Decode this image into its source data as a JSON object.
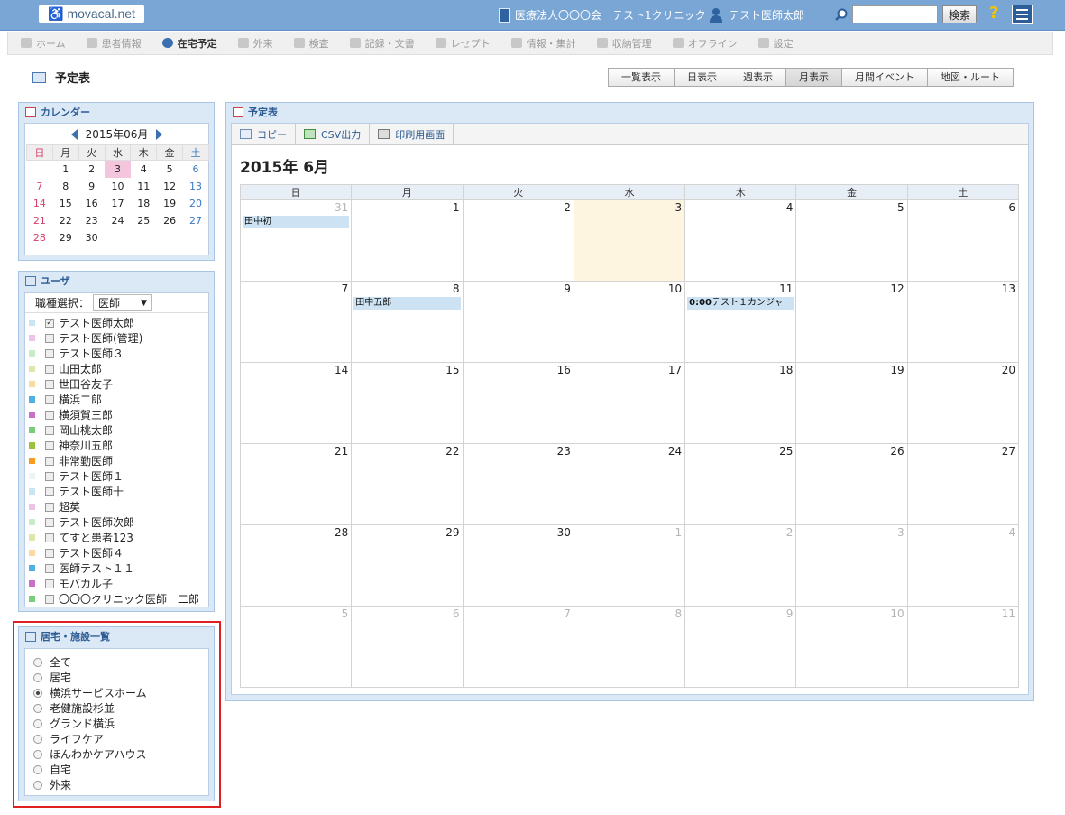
{
  "app": {
    "logo_text": "movacal.net",
    "organization": "医療法人〇〇〇会　テスト1クリニック",
    "username": "テスト医師太郎",
    "search_placeholder": "",
    "search_button": "検索",
    "help_label": "?"
  },
  "nav": [
    {
      "label": "ホーム",
      "icon": "home-icon",
      "active": false
    },
    {
      "label": "患者情報",
      "icon": "patients-icon",
      "active": false
    },
    {
      "label": "在宅予定",
      "icon": "clock-icon",
      "active": true
    },
    {
      "label": "外来",
      "icon": "outpatient-icon",
      "active": false
    },
    {
      "label": "検査",
      "icon": "exam-icon",
      "active": false
    },
    {
      "label": "記録・文書",
      "icon": "documents-icon",
      "active": false
    },
    {
      "label": "レセプト",
      "icon": "receipt-icon",
      "active": false
    },
    {
      "label": "情報・集計",
      "icon": "stats-icon",
      "active": false
    },
    {
      "label": "収納管理",
      "icon": "billing-icon",
      "active": false
    },
    {
      "label": "オフライン",
      "icon": "offline-icon",
      "active": false
    },
    {
      "label": "設定",
      "icon": "settings-icon",
      "active": false
    }
  ],
  "page": {
    "title": "予定表",
    "views": [
      "一覧表示",
      "日表示",
      "週表示",
      "月表示",
      "月間イベント",
      "地図・ルート"
    ],
    "active_view": "月表示"
  },
  "calendar_panel": {
    "title": "カレンダー",
    "month": "2015年06月",
    "weekdays": [
      "日",
      "月",
      "火",
      "水",
      "木",
      "金",
      "土"
    ],
    "weeks": [
      [
        "",
        "1",
        "2",
        "3",
        "4",
        "5",
        "6"
      ],
      [
        "7",
        "8",
        "9",
        "10",
        "11",
        "12",
        "13"
      ],
      [
        "14",
        "15",
        "16",
        "17",
        "18",
        "19",
        "20"
      ],
      [
        "21",
        "22",
        "23",
        "24",
        "25",
        "26",
        "27"
      ],
      [
        "28",
        "29",
        "30",
        "",
        "",
        "",
        ""
      ]
    ],
    "today": "3"
  },
  "users_panel": {
    "title": "ユーザ",
    "role_label": "職種選択：",
    "role_value": "医師",
    "users": [
      {
        "name": "テスト医師太郎",
        "color": "#c9e4f3",
        "checked": true
      },
      {
        "name": "テスト医師(管理)",
        "color": "#ebc4e8",
        "checked": false
      },
      {
        "name": "テスト医師３",
        "color": "#c8ecc8",
        "checked": false
      },
      {
        "name": "山田太郎",
        "color": "#dde8a8",
        "checked": false
      },
      {
        "name": "世田谷友子",
        "color": "#fbd9a0",
        "checked": false
      },
      {
        "name": "横浜二郎",
        "color": "#4fb0e4",
        "checked": false
      },
      {
        "name": "横須賀三郎",
        "color": "#c96fc9",
        "checked": false
      },
      {
        "name": "岡山桃太郎",
        "color": "#79cf79",
        "checked": false
      },
      {
        "name": "神奈川五郎",
        "color": "#9ac23c",
        "checked": false
      },
      {
        "name": "非常勤医師",
        "color": "#f79c1f",
        "checked": false
      },
      {
        "name": "テスト医師１",
        "color": "#eef3f6",
        "checked": false
      },
      {
        "name": "テスト医師十",
        "color": "#c9e4f3",
        "checked": false
      },
      {
        "name": "超英",
        "color": "#ebc4e8",
        "checked": false
      },
      {
        "name": "テスト医師次郎",
        "color": "#c8ecc8",
        "checked": false
      },
      {
        "name": "てすと患者123",
        "color": "#dde8a8",
        "checked": false
      },
      {
        "name": "テスト医師４",
        "color": "#fbd9a0",
        "checked": false
      },
      {
        "name": "医師テスト１１",
        "color": "#4fb0e4",
        "checked": false
      },
      {
        "name": "モバカル子",
        "color": "#c96fc9",
        "checked": false
      },
      {
        "name": "〇〇〇クリニック医師　二郎",
        "color": "#79cf79",
        "checked": false
      }
    ]
  },
  "facility_panel": {
    "title": "居宅・施設一覧",
    "options": [
      "全て",
      "居宅",
      "横浜サービスホーム",
      "老健施設杉並",
      "グランド横浜",
      "ライフケア",
      "ほんわかケアハウス",
      "自宅",
      "外来"
    ],
    "selected": "横浜サービスホーム"
  },
  "schedule": {
    "panel_title": "予定表",
    "toolbar": [
      {
        "label": "コピー",
        "icon": "copy-icon"
      },
      {
        "label": "CSV出力",
        "icon": "csv-icon"
      },
      {
        "label": "印刷用画面",
        "icon": "printer-icon"
      }
    ],
    "month_title": "2015年 6月",
    "weekdays": [
      "日",
      "月",
      "火",
      "水",
      "木",
      "金",
      "土"
    ],
    "weeks": [
      [
        {
          "d": "31",
          "o": true,
          "ev": [
            {
              "text": "田中初"
            }
          ]
        },
        {
          "d": "1"
        },
        {
          "d": "2"
        },
        {
          "d": "3",
          "today": true
        },
        {
          "d": "4"
        },
        {
          "d": "5"
        },
        {
          "d": "6"
        }
      ],
      [
        {
          "d": "7"
        },
        {
          "d": "8",
          "ev": [
            {
              "text": "田中五郎"
            }
          ]
        },
        {
          "d": "9"
        },
        {
          "d": "10"
        },
        {
          "d": "11",
          "ev": [
            {
              "time": "0:00",
              "text": "テスト１カンジャ"
            }
          ]
        },
        {
          "d": "12"
        },
        {
          "d": "13"
        }
      ],
      [
        {
          "d": "14"
        },
        {
          "d": "15"
        },
        {
          "d": "16"
        },
        {
          "d": "17"
        },
        {
          "d": "18"
        },
        {
          "d": "19"
        },
        {
          "d": "20"
        }
      ],
      [
        {
          "d": "21"
        },
        {
          "d": "22"
        },
        {
          "d": "23"
        },
        {
          "d": "24"
        },
        {
          "d": "25"
        },
        {
          "d": "26"
        },
        {
          "d": "27"
        }
      ],
      [
        {
          "d": "28"
        },
        {
          "d": "29"
        },
        {
          "d": "30"
        },
        {
          "d": "1",
          "o": true
        },
        {
          "d": "2",
          "o": true
        },
        {
          "d": "3",
          "o": true
        },
        {
          "d": "4",
          "o": true
        }
      ],
      [
        {
          "d": "5",
          "o": true
        },
        {
          "d": "6",
          "o": true
        },
        {
          "d": "7",
          "o": true
        },
        {
          "d": "8",
          "o": true
        },
        {
          "d": "9",
          "o": true
        },
        {
          "d": "10",
          "o": true
        },
        {
          "d": "11",
          "o": true
        }
      ]
    ]
  }
}
